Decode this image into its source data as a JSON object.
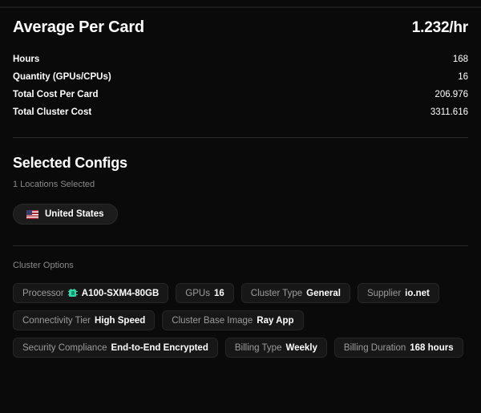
{
  "summary": {
    "title": "Average Per Card",
    "rate": "1.232/hr",
    "stats": [
      {
        "label": "Hours",
        "value": "168"
      },
      {
        "label": "Quantity (GPUs/CPUs)",
        "value": "16"
      },
      {
        "label": "Total Cost Per Card",
        "value": "206.976"
      },
      {
        "label": "Total Cluster Cost",
        "value": "3311.616"
      }
    ]
  },
  "selected_configs": {
    "title": "Selected Configs",
    "subtitle": "1 Locations Selected",
    "locations": [
      {
        "flag": "us-flag-icon",
        "label": "United States"
      }
    ]
  },
  "cluster_options": {
    "caption": "Cluster Options",
    "tags": [
      {
        "key": "Processor",
        "icon": "chip-icon",
        "value": "A100-SXM4-80GB"
      },
      {
        "key": "GPUs",
        "value": "16"
      },
      {
        "key": "Cluster Type",
        "value": "General"
      },
      {
        "key": "Supplier",
        "value": "io.net"
      },
      {
        "key": "Connectivity Tier",
        "value": "High Speed"
      },
      {
        "key": "Cluster Base Image",
        "value": "Ray App"
      },
      {
        "key": "Security Compliance",
        "value": "End-to-End Encrypted"
      },
      {
        "key": "Billing Type",
        "value": "Weekly"
      },
      {
        "key": "Billing Duration",
        "value": "168 hours"
      }
    ]
  },
  "colors": {
    "background": "#0a0a0a",
    "tag_background": "#171717",
    "tag_border": "#262626",
    "divider": "#2b2b2b",
    "muted_text": "#8a8a8a",
    "accent_chip": "#2fd6a3"
  }
}
